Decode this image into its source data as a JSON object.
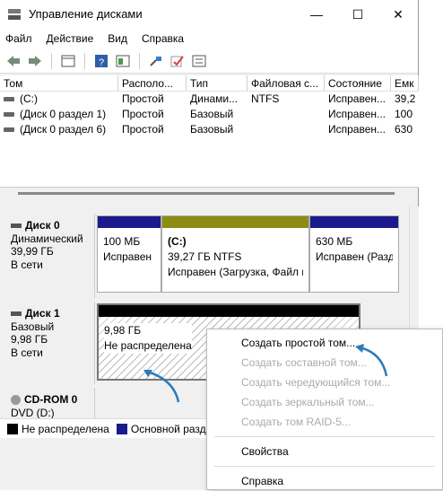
{
  "window": {
    "title": "Управление дисками"
  },
  "menu": [
    "Файл",
    "Действие",
    "Вид",
    "Справка"
  ],
  "columns": [
    "Том",
    "Располо...",
    "Тип",
    "Файловая с...",
    "Состояние",
    "Емк"
  ],
  "volumes": [
    {
      "name": "(C:)",
      "layout": "Простой",
      "type": "Динами...",
      "fs": "NTFS",
      "status": "Исправен...",
      "cap": "39,2"
    },
    {
      "name": "(Диск 0 раздел 1)",
      "layout": "Простой",
      "type": "Базовый",
      "fs": "",
      "status": "Исправен...",
      "cap": "100"
    },
    {
      "name": "(Диск 0 раздел 6)",
      "layout": "Простой",
      "type": "Базовый",
      "fs": "",
      "status": "Исправен...",
      "cap": "630"
    }
  ],
  "disk0": {
    "name": "Диск 0",
    "type": "Динамический",
    "size": "39,99 ГБ",
    "state": "В сети",
    "p1": {
      "size": "100 МБ",
      "status": "Исправен"
    },
    "p2": {
      "label": "(C:)",
      "size": "39,27 ГБ NTFS",
      "status": "Исправен (Загрузка, Файл и"
    },
    "p3": {
      "size": "630 МБ",
      "status": "Исправен (Разд"
    }
  },
  "disk1": {
    "name": "Диск 1",
    "type": "Базовый",
    "size": "9,98 ГБ",
    "state": "В сети",
    "p1": {
      "size": "9,98 ГБ",
      "status": "Не распределена"
    }
  },
  "cdrom": {
    "name": "CD-ROM 0",
    "type": "DVD (D:)"
  },
  "legend": {
    "unalloc": "Не распределена",
    "primary": "Основной раздел"
  },
  "context_menu": {
    "items": [
      {
        "label": "Создать простой том...",
        "enabled": true
      },
      {
        "label": "Создать составной том...",
        "enabled": false
      },
      {
        "label": "Создать чередующийся том...",
        "enabled": false
      },
      {
        "label": "Создать зеркальный том...",
        "enabled": false
      },
      {
        "label": "Создать том RAID-5...",
        "enabled": false
      }
    ],
    "properties": "Свойства",
    "help": "Справка"
  },
  "colors": {
    "primary": "#1a1a8c",
    "dynamic": "#8c8c14",
    "unalloc": "#000000",
    "arrow": "#2b7bb9"
  }
}
